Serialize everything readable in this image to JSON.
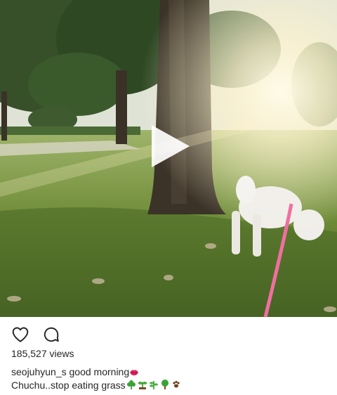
{
  "media": {
    "type": "video",
    "play_icon": "play-icon"
  },
  "actions": {
    "like_icon": "heart-icon",
    "comment_icon": "comment-icon"
  },
  "post": {
    "views": "185,527 views",
    "username": "seojuhyun_s",
    "caption_line1": "good morning",
    "caption_line1_emoji": "lips-emoji",
    "caption_line2": "Chuchu..stop eating grass",
    "caption_line2_emojis": [
      "shamrock-emoji",
      "seedling-emoji",
      "herb-emoji",
      "tree-emoji",
      "paw-prints-emoji"
    ]
  }
}
